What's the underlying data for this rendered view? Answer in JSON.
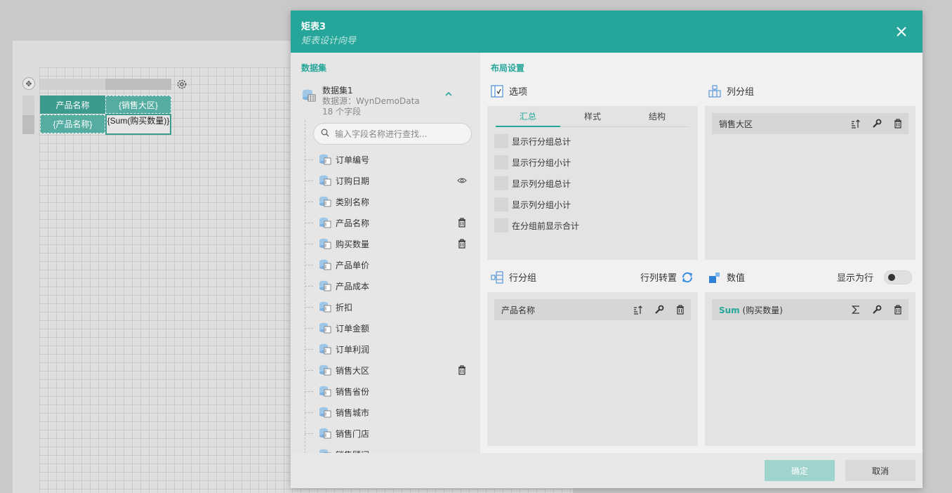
{
  "canvas": {
    "table": {
      "header_cells": [
        "产品名称",
        "{销售大区}"
      ],
      "data_cells": [
        "{产品名称}",
        "{Sum(购买数量)}"
      ]
    }
  },
  "dialog": {
    "title": "矩表3",
    "subtitle": "矩表设计向导",
    "accent_color": "#26a69a",
    "dataset_section": {
      "title": "数据集",
      "dataset": {
        "name": "数据集1",
        "source": "数据源：WynDemoData",
        "field_count": "18 个字段"
      },
      "search": {
        "placeholder": "输入字段名称进行查找..."
      },
      "fields": [
        {
          "label": "订单编号",
          "action": ""
        },
        {
          "label": "订购日期",
          "action": "eye-icon"
        },
        {
          "label": "类别名称",
          "action": ""
        },
        {
          "label": "产品名称",
          "action": "trash-icon"
        },
        {
          "label": "购买数量",
          "action": "trash-icon"
        },
        {
          "label": "产品单价",
          "action": ""
        },
        {
          "label": "产品成本",
          "action": ""
        },
        {
          "label": "折扣",
          "action": ""
        },
        {
          "label": "订单金额",
          "action": ""
        },
        {
          "label": "订单利润",
          "action": ""
        },
        {
          "label": "销售大区",
          "action": "trash-icon"
        },
        {
          "label": "销售省份",
          "action": ""
        },
        {
          "label": "销售城市",
          "action": ""
        },
        {
          "label": "销售门店",
          "action": ""
        },
        {
          "label": "销售顾问",
          "action": ""
        }
      ]
    },
    "layout_section": {
      "title": "布局设置",
      "options": {
        "title": "选项",
        "tabs": [
          "汇总",
          "样式",
          "结构"
        ],
        "active_tab": "汇总",
        "checkboxes": [
          "显示行分组总计",
          "显示行分组小计",
          "显示列分组总计",
          "显示列分组小计",
          "在分组前显示合计"
        ]
      },
      "column_groups": {
        "title": "列分组",
        "items": [
          "销售大区"
        ]
      },
      "row_groups": {
        "title": "行分组",
        "swap_label": "行列转置",
        "items": [
          "产品名称"
        ]
      },
      "values": {
        "title": "数值",
        "show_as_row_label": "显示为行",
        "show_as_row": false,
        "items": [
          {
            "agg": "Sum",
            "field": "(购买数量)"
          }
        ]
      }
    },
    "footer": {
      "ok_label": "确定",
      "cancel_label": "取消"
    }
  }
}
